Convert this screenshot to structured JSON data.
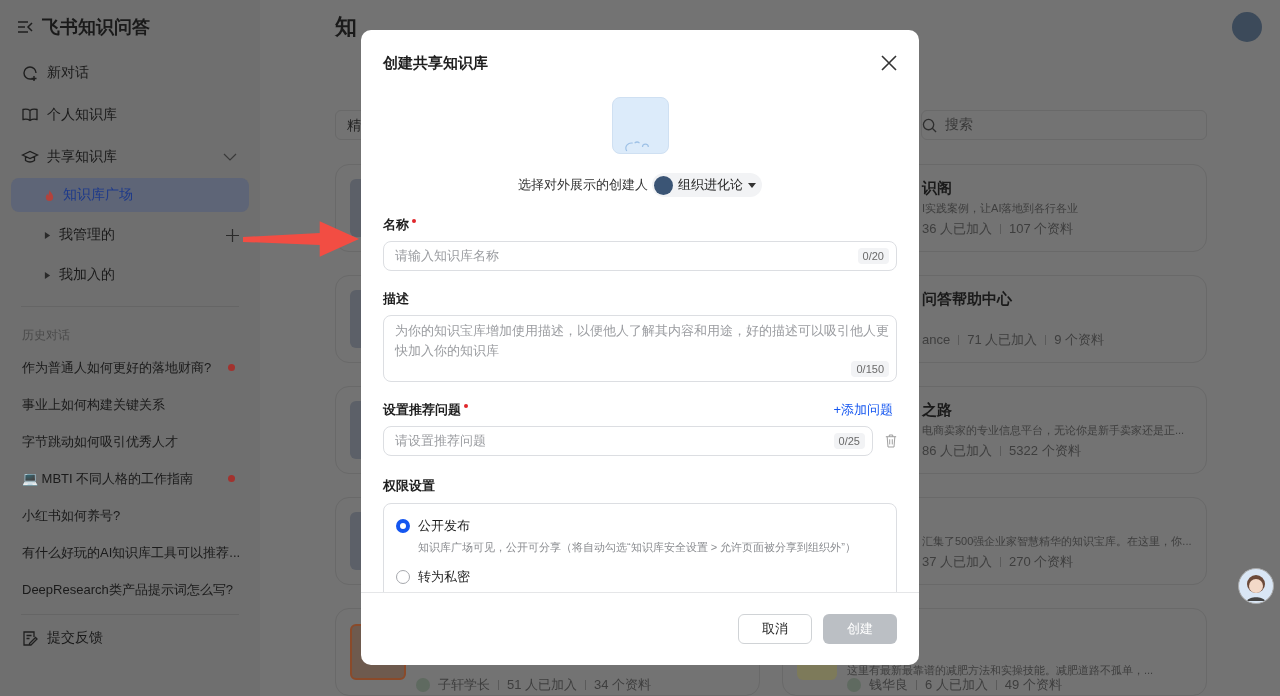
{
  "sidebar": {
    "title": "飞书知识问答",
    "nav": [
      {
        "label": "新对话",
        "kind": "new"
      },
      {
        "label": "个人知识库",
        "kind": "book"
      },
      {
        "label": "共享知识库",
        "kind": "shared",
        "expanded": true,
        "children": [
          {
            "label": "知识库广场",
            "kind": "hot",
            "selected": true
          },
          {
            "label": "我管理的",
            "kind": "folder",
            "selected": false,
            "expanded": false,
            "can_add": true
          },
          {
            "label": "我加入的",
            "kind": "folder",
            "selected": false,
            "expanded": false,
            "can_add": false
          }
        ]
      }
    ],
    "history_title": "历史对话",
    "history": [
      {
        "text": "作为普通人如何更好的落地财商?",
        "unread": true
      },
      {
        "text": "事业上如何构建关键关系",
        "unread": false
      },
      {
        "text": "字节跳动如何吸引优秀人才",
        "unread": false
      },
      {
        "text": "💻 MBTI 不同人格的工作指南",
        "unread": true
      },
      {
        "text": "小红书如何养号?",
        "unread": false
      },
      {
        "text": "有什么好玩的AI知识库工具可以推荐...",
        "unread": false
      },
      {
        "text": "DeepResearch类产品提示词怎么写?",
        "unread": false
      }
    ],
    "feedback": "提交反馈"
  },
  "page": {
    "heading": "知",
    "tab": "精",
    "search": {
      "placeholder": "搜索"
    },
    "cards": [
      {
        "title": "识阁",
        "description": "I实践案例，让AI落地到各行各业",
        "members": "36 人已加入",
        "docs": "107 个资料"
      },
      {
        "title": "问答帮助中心",
        "author": "ance",
        "members": "71 人已加入",
        "docs": "9 个资料"
      },
      {
        "title": "之路",
        "description": "电商卖家的专业信息平台，无论你是新手卖家还是正...",
        "members": "86 人已加入",
        "docs": "5322 个资料"
      },
      {
        "description": "汇集了500强企业家智慧精华的知识宝库。在这里，你...",
        "members": "37 人已加入",
        "docs": "270 个资料"
      }
    ],
    "bottom_cards": [
      {
        "author": "子轩学长",
        "members": "51 人已加入",
        "docs": "34 个资料"
      },
      {
        "description": "这里有最新最靠谱的减肥方法和实操技能。减肥道路不孤单，...",
        "author": "钱华良",
        "members": "6 人已加入",
        "docs": "49 个资料"
      }
    ]
  },
  "dialog": {
    "title": "创建共享知识库",
    "creator_label": "选择对外展示的创建人",
    "creator": "组织进化论",
    "fields": [
      {
        "label": "名称",
        "required": true,
        "kind": "input",
        "placeholder": "请输入知识库名称",
        "counter": "0/20"
      },
      {
        "label": "描述",
        "required": false,
        "kind": "textarea",
        "placeholder": "为你的知识宝库增加使用描述，以便他人了解其内容和用途，好的描述可以吸引他人更快加入你的知识库",
        "counter": "0/150"
      },
      {
        "label": "设置推荐问题",
        "required": true,
        "kind": "question",
        "placeholder": "请设置推荐问题",
        "counter": "0/25",
        "action": "+添加问题"
      }
    ],
    "permission_label": "权限设置",
    "permissions": [
      {
        "label": "公开发布",
        "description": "知识库广场可见，公开可分享（将自动勾选“知识库安全设置 > 允许页面被分享到组织外”）",
        "selected": true
      },
      {
        "label": "转为私密",
        "selected": false
      }
    ],
    "buttons": [
      {
        "label": "取消",
        "kind": "secondary"
      },
      {
        "label": "创建",
        "kind": "primary",
        "disabled": true
      }
    ]
  }
}
